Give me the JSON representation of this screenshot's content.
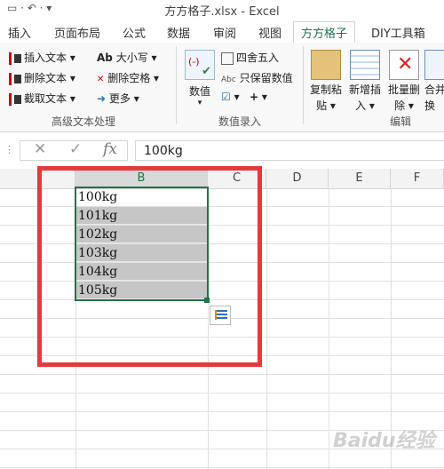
{
  "window": {
    "title": "方方格子.xlsx - Excel"
  },
  "ribbon_tabs": [
    "插入",
    "页面布局",
    "公式",
    "数据",
    "审阅",
    "视图",
    "方方格子",
    "DIY工具箱"
  ],
  "active_tab_index": 6,
  "ribbon": {
    "text_group": {
      "items": [
        "插入文本",
        "删除文本",
        "截取文本",
        "大小写",
        "删除空格",
        "更多"
      ],
      "label": "高级文本处理"
    },
    "number_group": {
      "value_label": "数值",
      "round_label": "四舍五入",
      "keep_value_label": "只保留数值",
      "label": "数值录入"
    },
    "edit_group": {
      "items": [
        "复制粘贴",
        "新增插入",
        "批量删除",
        "合并转换"
      ],
      "items_line1": [
        "复制粘",
        "新增插",
        "批量删",
        "合并"
      ],
      "items_line2": [
        "贴",
        "入",
        "除",
        "换"
      ],
      "label": "编辑"
    }
  },
  "formula_bar": {
    "value": "100kg"
  },
  "columns": [
    "B",
    "C",
    "D",
    "E",
    "F"
  ],
  "selected_column": "B",
  "cells": [
    "100kg",
    "101kg",
    "102kg",
    "103kg",
    "104kg",
    "105kg"
  ],
  "watermark": "Baidu经验",
  "colors": {
    "accent": "#217346",
    "highlight_box": "#e5393a",
    "selection_fill": "#c6c6c6"
  }
}
